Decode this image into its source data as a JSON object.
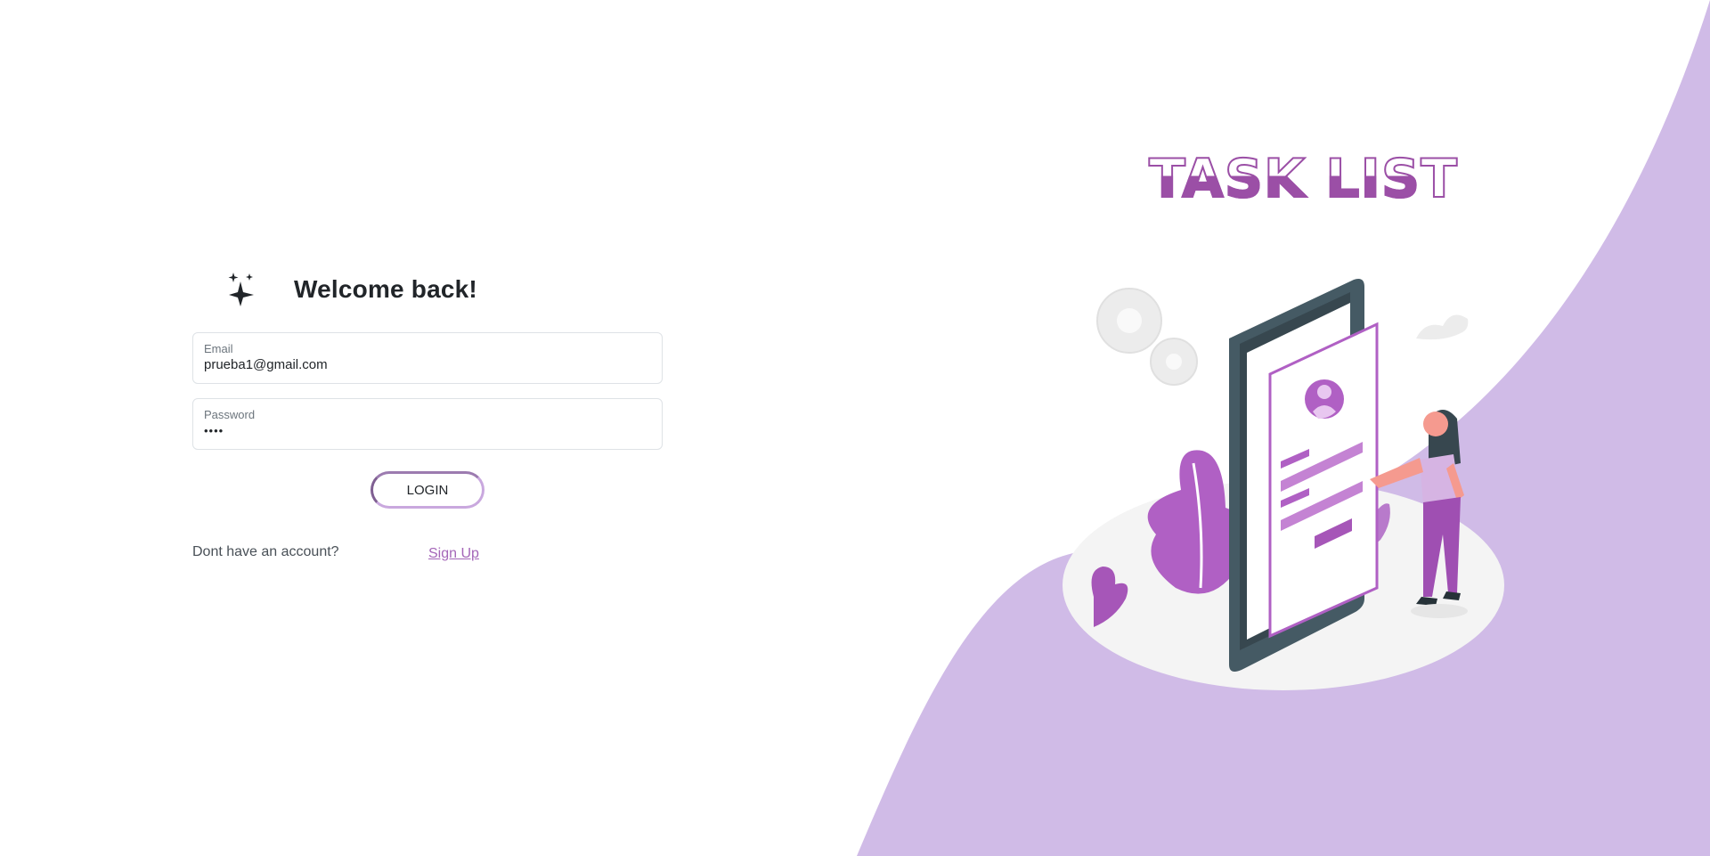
{
  "login": {
    "welcome_title": "Welcome back!",
    "icon": "sparkles-icon",
    "email": {
      "label": "Email",
      "value": "prueba1@gmail.com"
    },
    "password": {
      "label": "Password",
      "masked_value": "••••"
    },
    "login_label": "LOGIN",
    "signup_prompt": "Dont have an account?",
    "signup_link": "Sign Up"
  },
  "brand": {
    "app_title": "TASK LIST"
  },
  "colors": {
    "accent": "#a466b8",
    "accent_dark": "#9b4fa6",
    "lavender_bg": "#d0bbe7",
    "text": "#212529"
  }
}
